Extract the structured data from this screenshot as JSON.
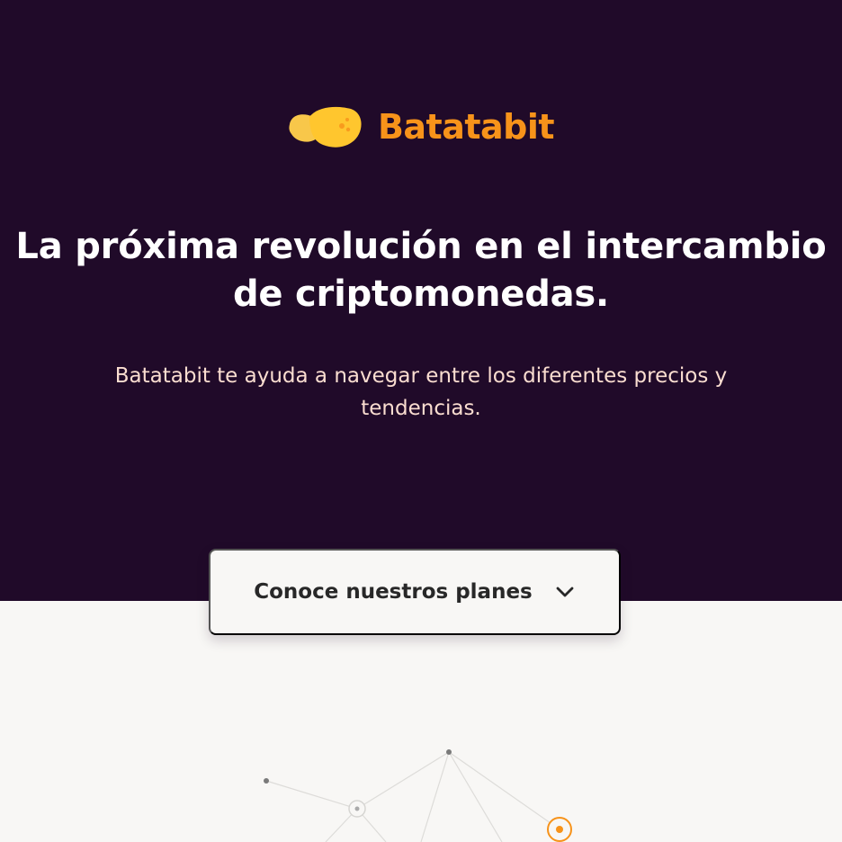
{
  "brand": {
    "name": "Batatabit",
    "logo_icon": "batatabit-logo-icon",
    "color": "#F7931A"
  },
  "hero": {
    "headline": "La próxima revolución en el intercambio de criptomonedas.",
    "subtitle": "Batatabit te ayuda a navegar entre los diferentes precios y tendencias.",
    "background_color": "#200A29",
    "headline_color": "#FFFFFF",
    "subtitle_color": "#FADDD0"
  },
  "plans_button": {
    "label": "Conoce nuestros planes",
    "icon": "chevron-down-icon"
  },
  "colors": {
    "page_background": "#F8F7F5",
    "accent": "#F7931A"
  }
}
